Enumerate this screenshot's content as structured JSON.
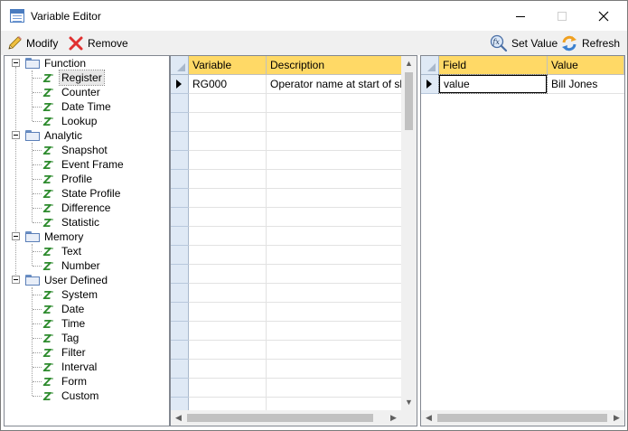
{
  "window": {
    "title": "Variable Editor",
    "controls": {
      "minimize_icon": "minimize-icon",
      "maximize_icon": "maximize-icon",
      "close_icon": "close-icon"
    }
  },
  "toolbar": {
    "modify_label": "Modify",
    "remove_label": "Remove",
    "set_value_label": "Set Value",
    "refresh_label": "Refresh"
  },
  "tree": {
    "groups": [
      {
        "label": "Function",
        "children": [
          "Register",
          "Counter",
          "Date Time",
          "Lookup"
        ]
      },
      {
        "label": "Analytic",
        "children": [
          "Snapshot",
          "Event Frame",
          "Profile",
          "State Profile",
          "Difference",
          "Statistic"
        ]
      },
      {
        "label": "Memory",
        "children": [
          "Text",
          "Number"
        ]
      },
      {
        "label": "User Defined",
        "children": [
          "System",
          "Date",
          "Time",
          "Tag",
          "Filter",
          "Interval",
          "Form",
          "Custom"
        ]
      }
    ],
    "selected": "Register"
  },
  "variables_grid": {
    "columns": [
      "Variable",
      "Description"
    ],
    "rows": [
      {
        "variable": "RG000",
        "description": "Operator name at start of shift"
      }
    ]
  },
  "fields_grid": {
    "columns": [
      "Field",
      "Value"
    ],
    "rows": [
      {
        "field": "value",
        "value": "Bill Jones"
      }
    ]
  },
  "colors": {
    "header_bg": "#ffd966",
    "row_header_bg": "#dfe9f5",
    "toolbar_bg": "#f0f0f0",
    "remove_icon_color": "#e03030"
  }
}
